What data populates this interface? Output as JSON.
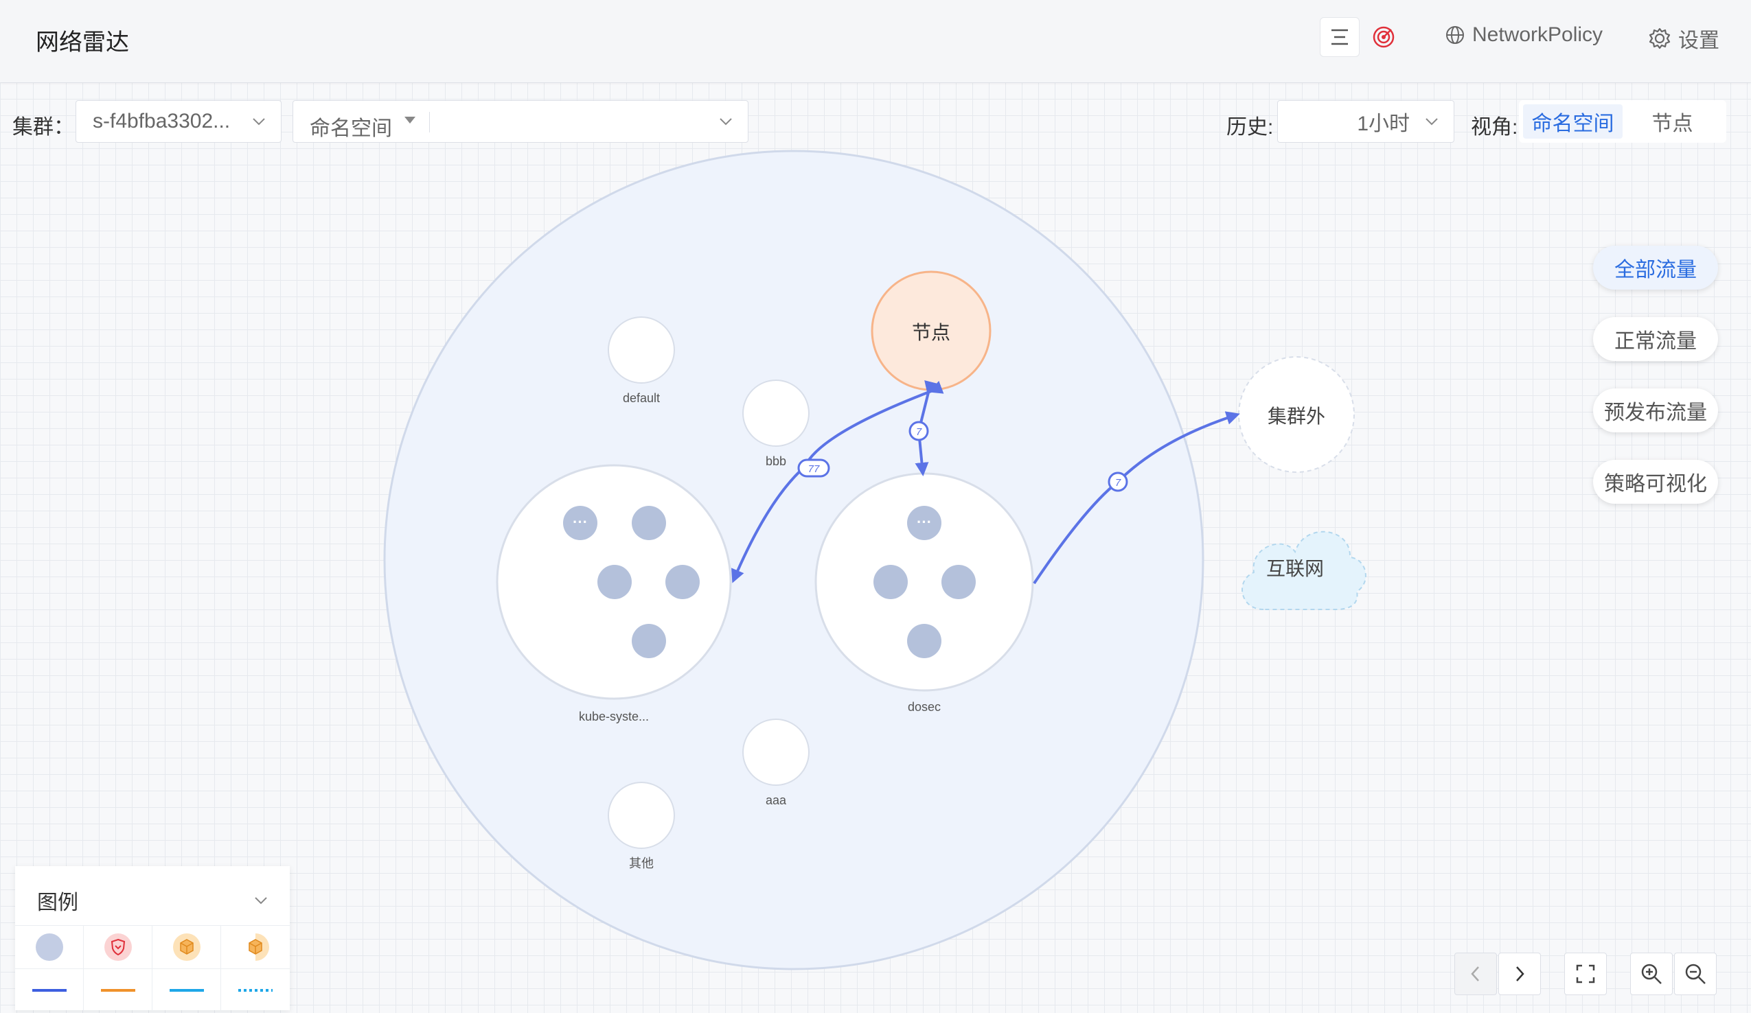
{
  "header": {
    "title": "网络雷达",
    "network_policy_label": "NetworkPolicy",
    "settings_label": "设置"
  },
  "filters": {
    "cluster_label": "集群：",
    "cluster_value": "s-f4bfba3302...",
    "namespace_placeholder": "命名空间",
    "history_label": "历史:",
    "history_value": "1小时",
    "view_label": "视角:",
    "view_options": [
      "命名空间",
      "节点"
    ],
    "view_selected": "命名空间"
  },
  "traffic_filters": [
    "全部流量",
    "正常流量",
    "预发布流量",
    "策略可视化"
  ],
  "traffic_selected": "全部流量",
  "graph": {
    "namespaces": {
      "default": "default",
      "bbb": "bbb",
      "kube": "kube-syste...",
      "dosec": "dosec",
      "aaa": "aaa",
      "other": "其他"
    },
    "node_label": "节点",
    "outside_label": "集群外",
    "internet_label": "互联网",
    "edge_labels": {
      "node_kube": "77",
      "node_dosec": "7",
      "dosec_outside": "7"
    }
  },
  "legend": {
    "title": "图例",
    "icons": [
      "pod-icon",
      "shield-icon",
      "cube-icon",
      "cube-half-icon"
    ],
    "line_styles": [
      "blue-solid",
      "orange-solid",
      "cyan-solid",
      "cyan-dotted"
    ]
  },
  "colors": {
    "accent": "#2a6ce0",
    "edge": "#5b73e6",
    "node_fill": "#fde9dc",
    "node_stroke": "#f7b489",
    "pod": "#b4c1db"
  }
}
